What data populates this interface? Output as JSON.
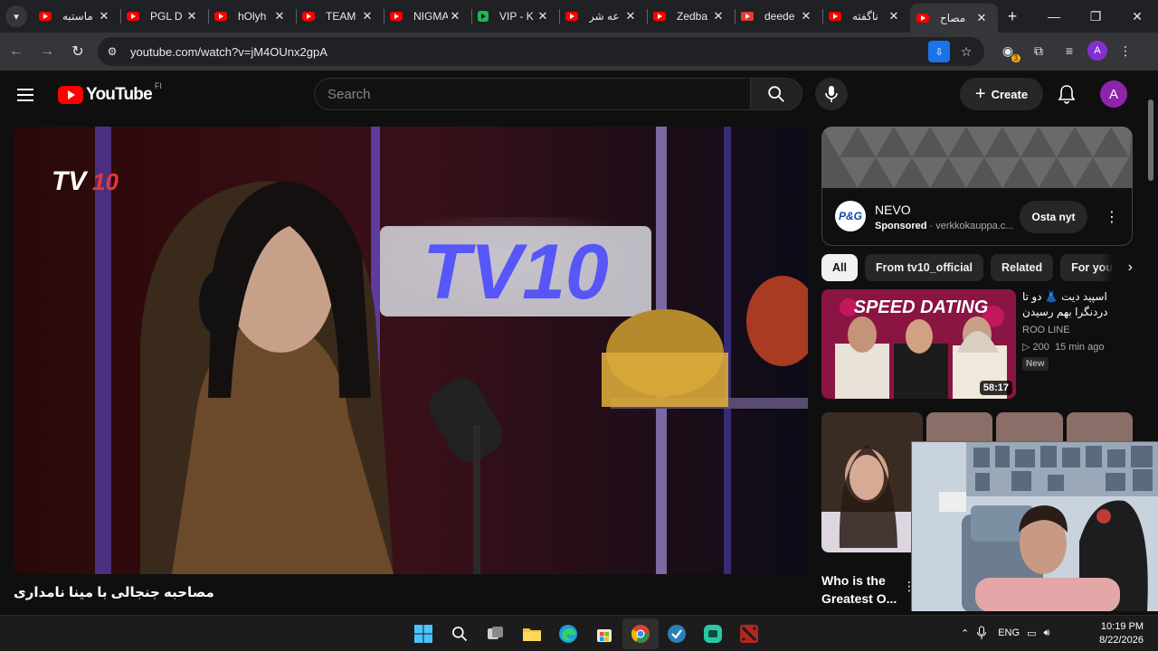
{
  "browser": {
    "tabs": [
      {
        "title": "ماستبه",
        "icon": "youtube-icon"
      },
      {
        "title": "PGL D",
        "icon": "youtube-icon"
      },
      {
        "title": "hOlyh",
        "icon": "youtube-icon"
      },
      {
        "title": "TEAM",
        "icon": "youtube-icon"
      },
      {
        "title": "NIGMA",
        "icon": "youtube-icon"
      },
      {
        "title": "VIP - K",
        "icon": "kick-icon"
      },
      {
        "title": "عه شر",
        "icon": "youtube-icon"
      },
      {
        "title": "Zedba",
        "icon": "youtube-icon"
      },
      {
        "title": "deede",
        "icon": "soundcloud-icon"
      },
      {
        "title": "ناگفته",
        "icon": "youtube-icon"
      },
      {
        "title": "مصاح",
        "icon": "youtube-icon",
        "active": true
      }
    ],
    "url": "youtube.com/watch?v=jM4OUnx2gpA",
    "extensions_badge": "3",
    "profile_initial": "A"
  },
  "youtube": {
    "logo_text": "YouTube",
    "country_code": "FI",
    "search_placeholder": "Search",
    "create_label": "Create",
    "avatar_initial": "A"
  },
  "video": {
    "title": "مصاحبه جنجالی با مینا نامداری",
    "channel_brand": "TV10"
  },
  "ad": {
    "brand": "NEVO",
    "logo_text": "P&G",
    "sponsored_label": "Sponsored",
    "advertiser": "verkkokauppa.c...",
    "cta": "Osta nyt"
  },
  "chips": [
    "All",
    "From tv10_official",
    "Related",
    "For you"
  ],
  "recommendations": [
    {
      "title": "اسپید دیت 👗 دو تا دردنگرا بهم رسیدن",
      "thumb_text": "SPEED DATING",
      "channel": "ROO LINE",
      "views": "200",
      "age": "15 min ago",
      "badge": "New",
      "duration": "58:17"
    },
    {
      "title": "Who is the Greatest O..."
    }
  ],
  "taskbar": {
    "language": "ENG",
    "time": "10:19 PM",
    "date": "8/22/2026"
  },
  "colors": {
    "youtube_red": "#ff0000",
    "background": "#0f0f0f",
    "chrome_tab_bg": "#202124",
    "chrome_toolbar": "#35363a",
    "avatar_purple": "#8e24aa"
  }
}
